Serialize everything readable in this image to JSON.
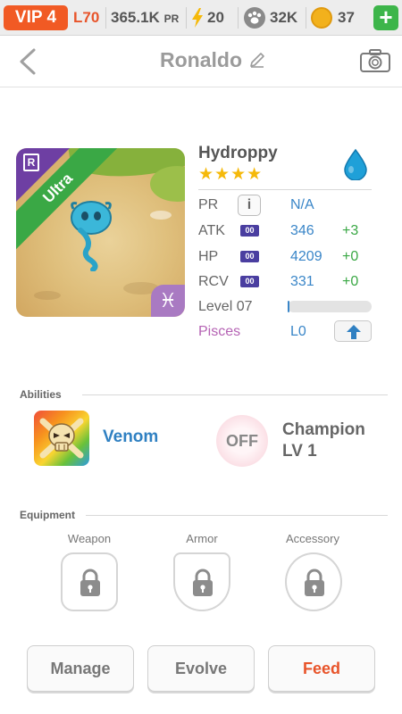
{
  "topbar": {
    "vip": "VIP 4",
    "level": "L70",
    "power": "365.1K",
    "power_suffix": "PR",
    "energy": "20",
    "food": "32K",
    "coins": "37",
    "add_label": "+"
  },
  "header": {
    "title": "Ronaldo"
  },
  "monster": {
    "name": "Hydroppy",
    "stars": "★★★★",
    "rarity": "Ultra",
    "card_badge": "R",
    "zodiac_glyph": "♓",
    "element": "water",
    "stats": {
      "pr_label": "PR",
      "info_label": "i",
      "pr_value": "N/A",
      "atk_label": "ATK",
      "atk_badge": "00",
      "atk_value": "346",
      "atk_bonus": "+3",
      "hp_label": "HP",
      "hp_badge": "00",
      "hp_value": "4209",
      "hp_bonus": "+0",
      "rcv_label": "RCV",
      "rcv_badge": "00",
      "rcv_value": "331",
      "rcv_bonus": "+0",
      "level_label": "Level 07",
      "level_progress": 0.02,
      "zodiac_label": "Pisces",
      "zodiac_level": "L0"
    }
  },
  "abilities": {
    "section_title": "Abilities",
    "primary_name": "Venom",
    "secondary_state": "OFF",
    "champion_title": "Champion",
    "champion_level": "LV 1"
  },
  "equipment": {
    "section_title": "Equipment",
    "weapon_label": "Weapon",
    "armor_label": "Armor",
    "accessory_label": "Accessory"
  },
  "actions": {
    "manage": "Manage",
    "evolve": "Evolve",
    "feed": "Feed"
  },
  "colors": {
    "accent_orange": "#f15a24",
    "value_blue": "#3a86c8",
    "bonus_green": "#3aa845",
    "zodiac_purple": "#b563b4"
  }
}
